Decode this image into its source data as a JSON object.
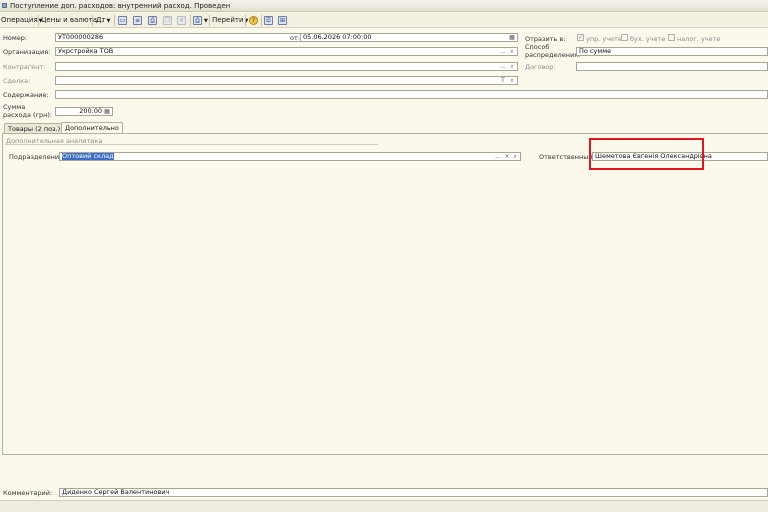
{
  "window": {
    "title": "Поступление доп. расходов: внутренний расход. Проведен"
  },
  "toolbar": {
    "operation": "Операция",
    "prices": "Цены и валюта...",
    "goto": "Перейти"
  },
  "header": {
    "number_label": "Номер:",
    "number_value": "УТ000000286",
    "date_label": "от:",
    "date_value": "05.06.2026 07:00:00",
    "org_label": "Организация:",
    "org_value": "Укрстройка ТОВ",
    "counterparty_label": "Контрагент:",
    "deal_label": "Сделка:",
    "content_label": "Содержание:",
    "sum_label_1": "Сумма",
    "sum_label_2": "расхода (грн):",
    "sum_value": "200.00",
    "reflect_label": "Отразить в:",
    "reflect_mgmt": "упр. учете",
    "reflect_acc": "бух. учете",
    "reflect_tax": "налог. учете",
    "distribution_label_1": "Способ",
    "distribution_label_2": "распределения:",
    "distribution_value": "По сумме",
    "contract_label": "Договор:"
  },
  "tabs": [
    {
      "label": "Товары (2 поз.)"
    },
    {
      "label": "Дополнительно"
    }
  ],
  "additional": {
    "section_title": "Дополнительная аналитика",
    "division_label": "Подразделение:",
    "division_value": "Оптовий склад",
    "responsible_label": "Ответственный:",
    "responsible_value": "Шеметова Євгенія Олександрівна"
  },
  "footer": {
    "comment_label": "Комментарий:",
    "comment_value": "Диденко Сергей Валентинович"
  },
  "colors": {
    "background": "#fbf8ec",
    "highlight": "#e0161f",
    "selection": "#3b6cc7"
  }
}
